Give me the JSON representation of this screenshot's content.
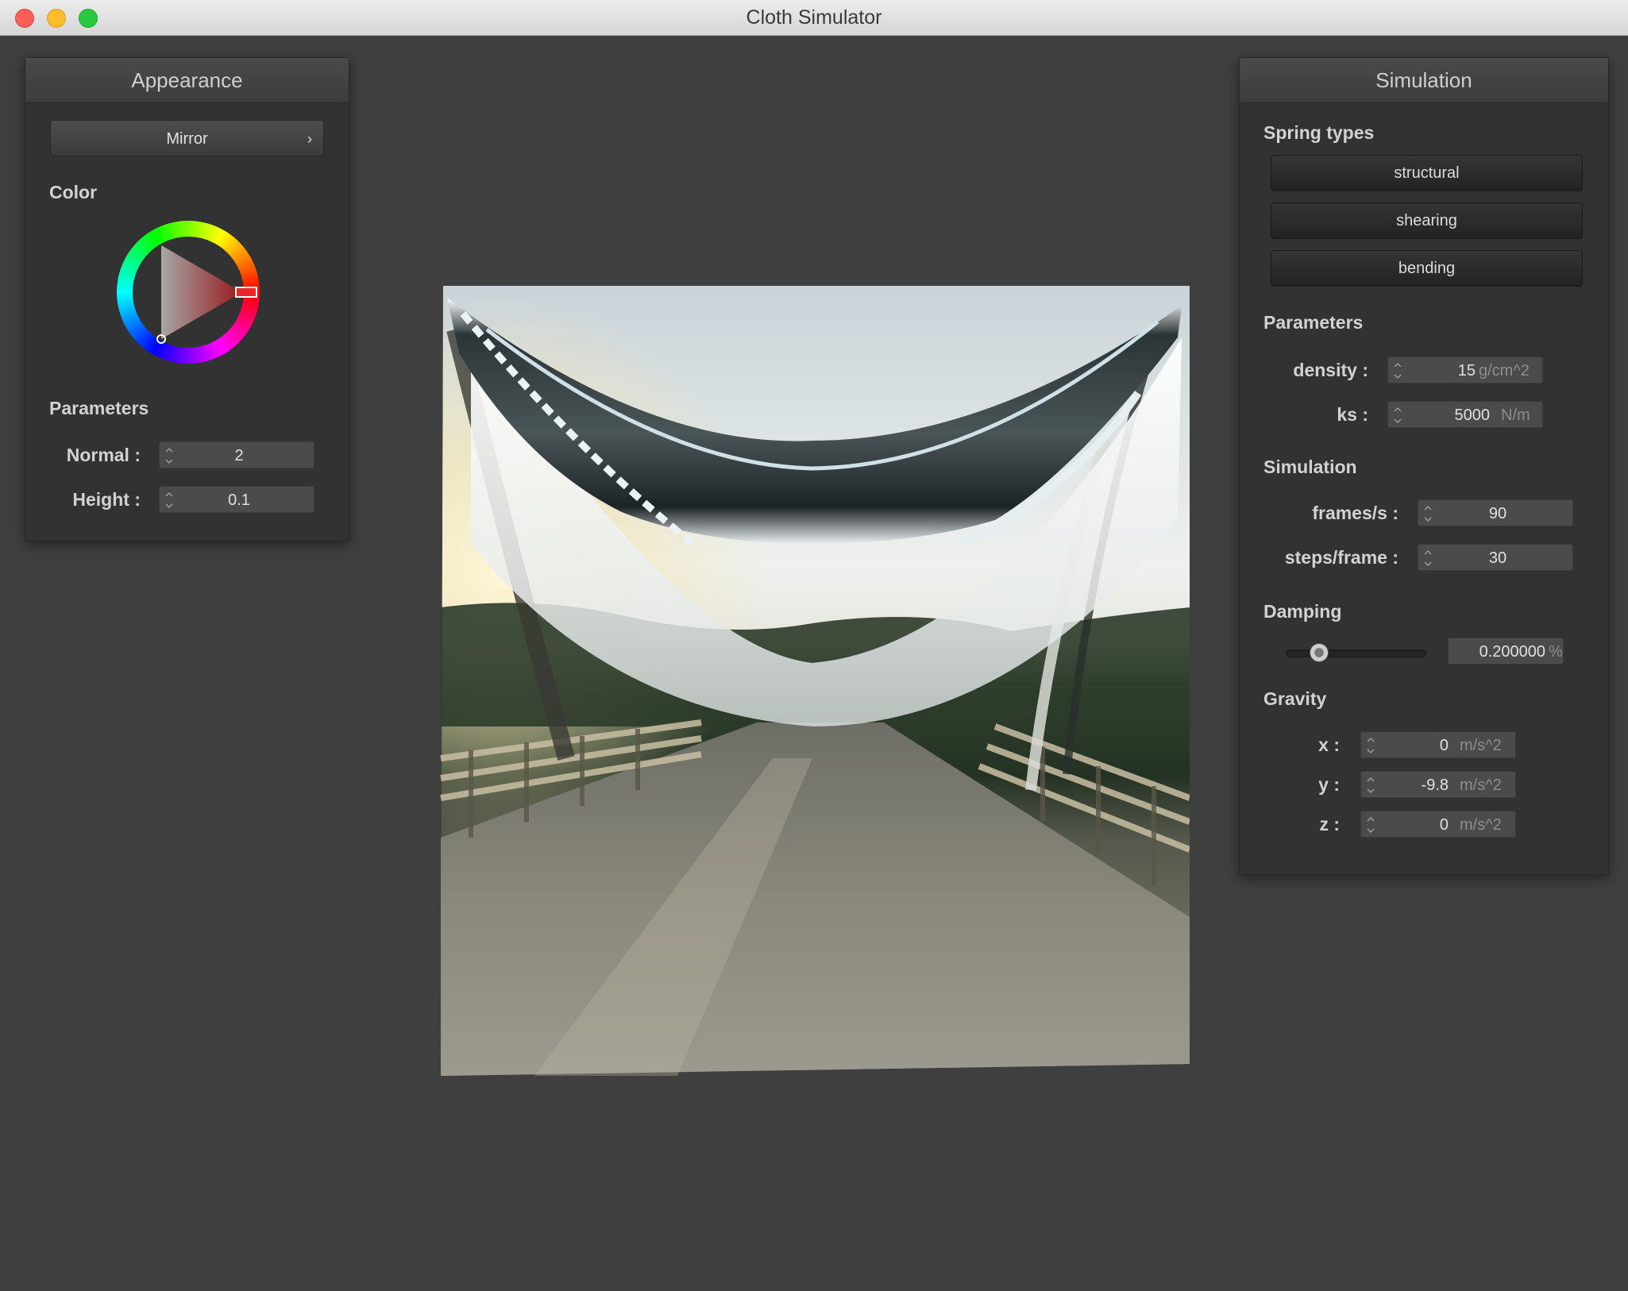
{
  "window": {
    "title": "Cloth Simulator"
  },
  "appearance": {
    "title": "Appearance",
    "shader": "Mirror",
    "color_label": "Color",
    "color_value": "#e8262a",
    "parameters_label": "Parameters",
    "normal_label": "Normal :",
    "normal_value": "2",
    "height_label": "Height :",
    "height_value": "0.1"
  },
  "simulation": {
    "title": "Simulation",
    "spring_types_label": "Spring types",
    "springs": [
      "structural",
      "shearing",
      "bending"
    ],
    "parameters_label": "Parameters",
    "density_label": "density :",
    "density_value": "15",
    "density_unit": "g/cm^2",
    "ks_label": "ks :",
    "ks_value": "5000",
    "ks_unit": "N/m",
    "sim_label": "Simulation",
    "fps_label": "frames/s :",
    "fps_value": "90",
    "steps_label": "steps/frame :",
    "steps_value": "30",
    "damping_label": "Damping",
    "damping_value": "0.200000",
    "damping_unit": "%",
    "damping_fraction": 0.2,
    "gravity_label": "Gravity",
    "gx_label": "x :",
    "gx_value": "0",
    "gy_label": "y :",
    "gy_value": "-9.8",
    "gz_label": "z :",
    "gz_value": "0",
    "g_unit": "m/s^2"
  }
}
